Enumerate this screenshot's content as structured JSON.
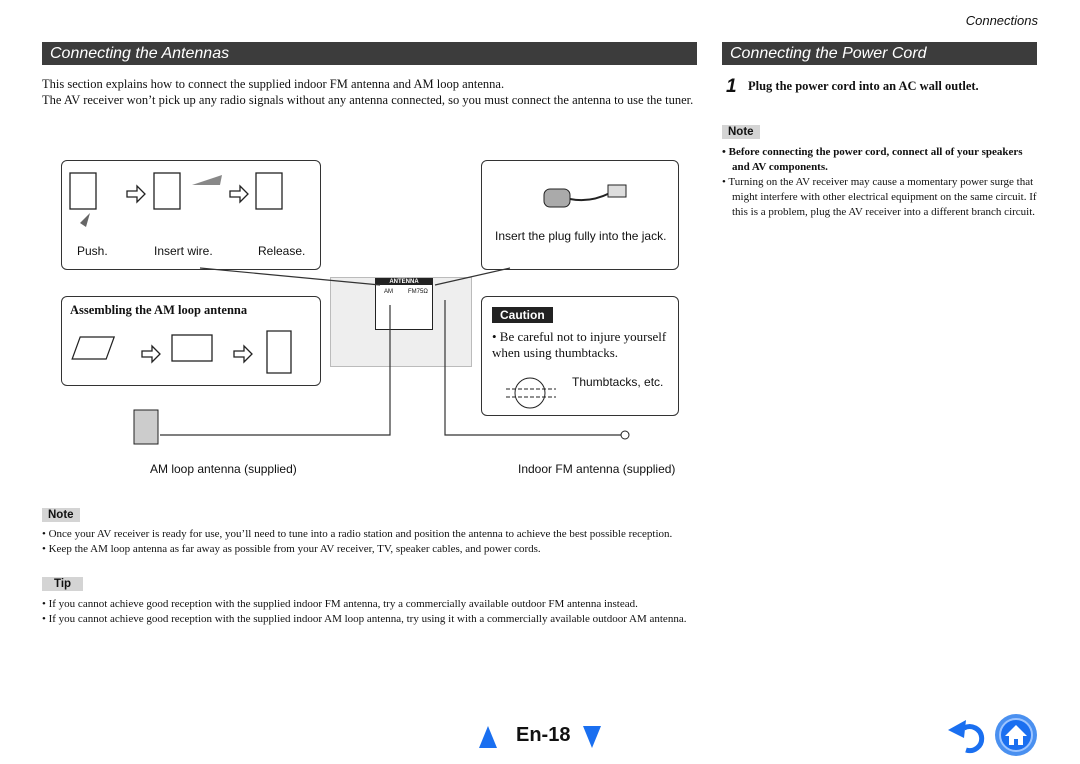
{
  "header": {
    "section": "Connections"
  },
  "left": {
    "title": "Connecting the Antennas",
    "intro": [
      "This section explains how to connect the supplied indoor FM antenna and AM loop antenna.",
      "The AV receiver won’t pick up any radio signals without any antenna connected, so you must connect the antenna to use the tuner."
    ],
    "figure": {
      "steps": [
        "Push.",
        "Insert wire.",
        "Release."
      ],
      "fm_plug": "Insert the plug fully into the jack.",
      "am_title": "Assembling the AM loop antenna",
      "caution_label": "Caution",
      "caution_text": "• Be careful not to injure yourself when using thumbtacks.",
      "thumbtacks": "Thumbtacks, etc.",
      "am_caption": "AM loop antenna (supplied)",
      "fm_caption": "Indoor FM antenna (supplied)",
      "panel": {
        "antenna": "ANTENNA",
        "am": "AM",
        "fm": "FM75Ω"
      }
    },
    "note_label": "Note",
    "notes": [
      "Once your AV receiver is ready for use, you’ll need to tune into a radio station and position the antenna to achieve the best possible reception.",
      "Keep the AM loop antenna as far away as possible from your AV receiver, TV, speaker cables, and power cords."
    ],
    "tip_label": "Tip",
    "tips": [
      "If you cannot achieve good reception with the supplied indoor FM antenna, try a commercially available outdoor FM antenna instead.",
      "If you cannot achieve good reception with the supplied indoor AM loop antenna, try using it with a commercially available outdoor AM antenna."
    ]
  },
  "right": {
    "title": "Connecting the Power Cord",
    "step_num": "1",
    "step_text": "Plug the power cord into an AC wall outlet.",
    "note_label": "Note",
    "notes": [
      "Before connecting the power cord, connect all of your speakers and AV components.",
      "Turning on the AV receiver may cause a momentary power surge that might interfere with other electrical equipment on the same circuit. If this is a problem, plug the AV receiver into a different branch circuit."
    ]
  },
  "footer": {
    "page": "En-18",
    "accent": "#1a6ff0"
  }
}
